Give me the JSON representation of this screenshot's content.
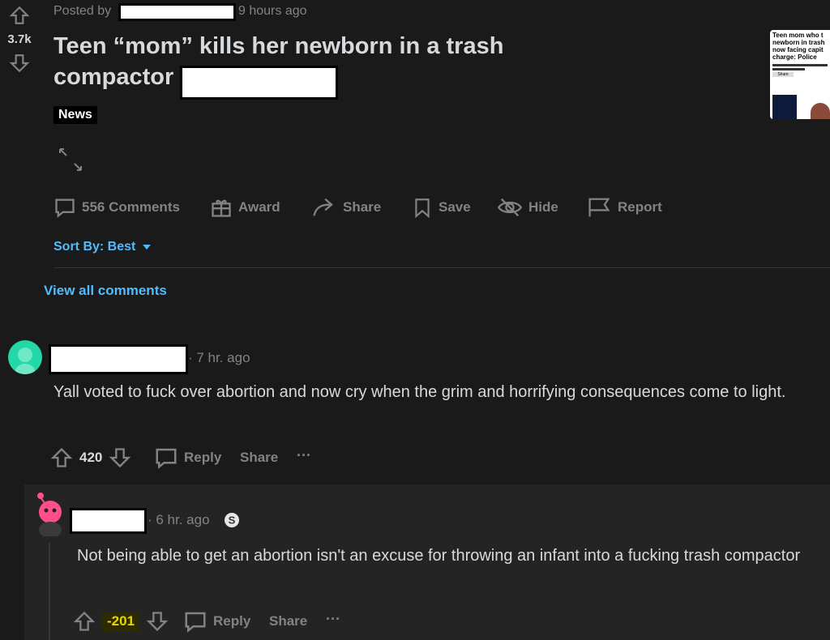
{
  "post": {
    "posted_by_label": "Posted by",
    "time": "9 hours ago",
    "score": "3.7k",
    "title": "Teen “mom” kills her newborn in a trash compactor",
    "flair": "News",
    "thumbnail_text": "Teen mom who t newborn in trash now facing capit charge: Police",
    "thumbnail_button": "Share"
  },
  "actions": {
    "comments": "556 Comments",
    "award": "Award",
    "share": "Share",
    "save": "Save",
    "hide": "Hide",
    "report": "Report"
  },
  "sort": {
    "label": "Sort By: Best"
  },
  "view_all": "View all comments",
  "comments": [
    {
      "time": "· 7 hr. ago",
      "text": "Yall voted to fuck over abortion and now cry when the grim and horrifying consequences come to light.",
      "score": "420",
      "reply": "Reply",
      "share": "Share",
      "more": "···"
    },
    {
      "time": "· 6 hr. ago",
      "text": "Not being able to get an abortion isn't an excuse for throwing an infant into a fucking trash compactor",
      "score": "-201",
      "reply": "Reply",
      "share": "Share",
      "more": "···"
    }
  ],
  "colors": {
    "background": "#1a1a1b",
    "link": "#4fbcff",
    "negative_highlight": "#e8d600",
    "avatar": "#24d7a8",
    "avatar2": "#ff4f8b"
  }
}
